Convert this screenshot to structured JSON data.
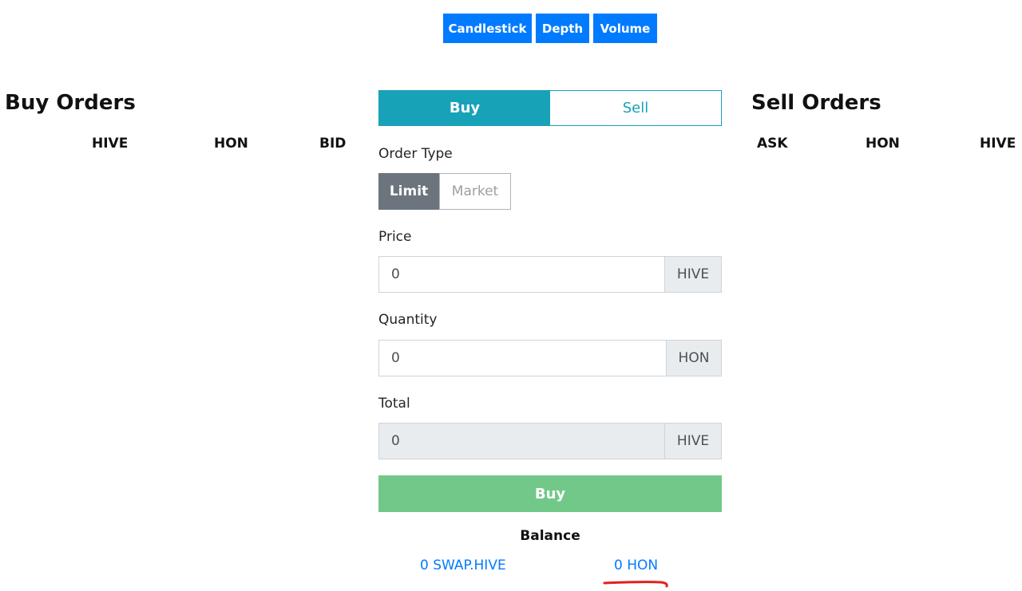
{
  "chart_tabs": {
    "candlestick": "Candlestick",
    "depth": "Depth",
    "volume": "Volume"
  },
  "buy_orders": {
    "title": "Buy Orders",
    "columns": [
      "HIVE",
      "HON",
      "BID"
    ]
  },
  "sell_orders": {
    "title": "Sell Orders",
    "columns": [
      "ASK",
      "HON",
      "HIVE"
    ]
  },
  "order_form": {
    "side_buy": "Buy",
    "side_sell": "Sell",
    "active_side": "Buy",
    "order_type_label": "Order Type",
    "order_type_limit": "Limit",
    "order_type_market": "Market",
    "active_order_type": "Limit",
    "price_label": "Price",
    "price_value": "0",
    "price_unit": "HIVE",
    "quantity_label": "Quantity",
    "quantity_value": "0",
    "quantity_unit": "HON",
    "total_label": "Total",
    "total_value": "0",
    "total_unit": "HIVE",
    "submit_label": "Buy"
  },
  "balance": {
    "title": "Balance",
    "swap_hive": "0 SWAP.HIVE",
    "hon": "0 HON"
  },
  "colors": {
    "primary": "#007bff",
    "info": "#17a2b8",
    "secondary": "#6c757d",
    "success_light": "#72c889",
    "annotation": "#e02020"
  }
}
